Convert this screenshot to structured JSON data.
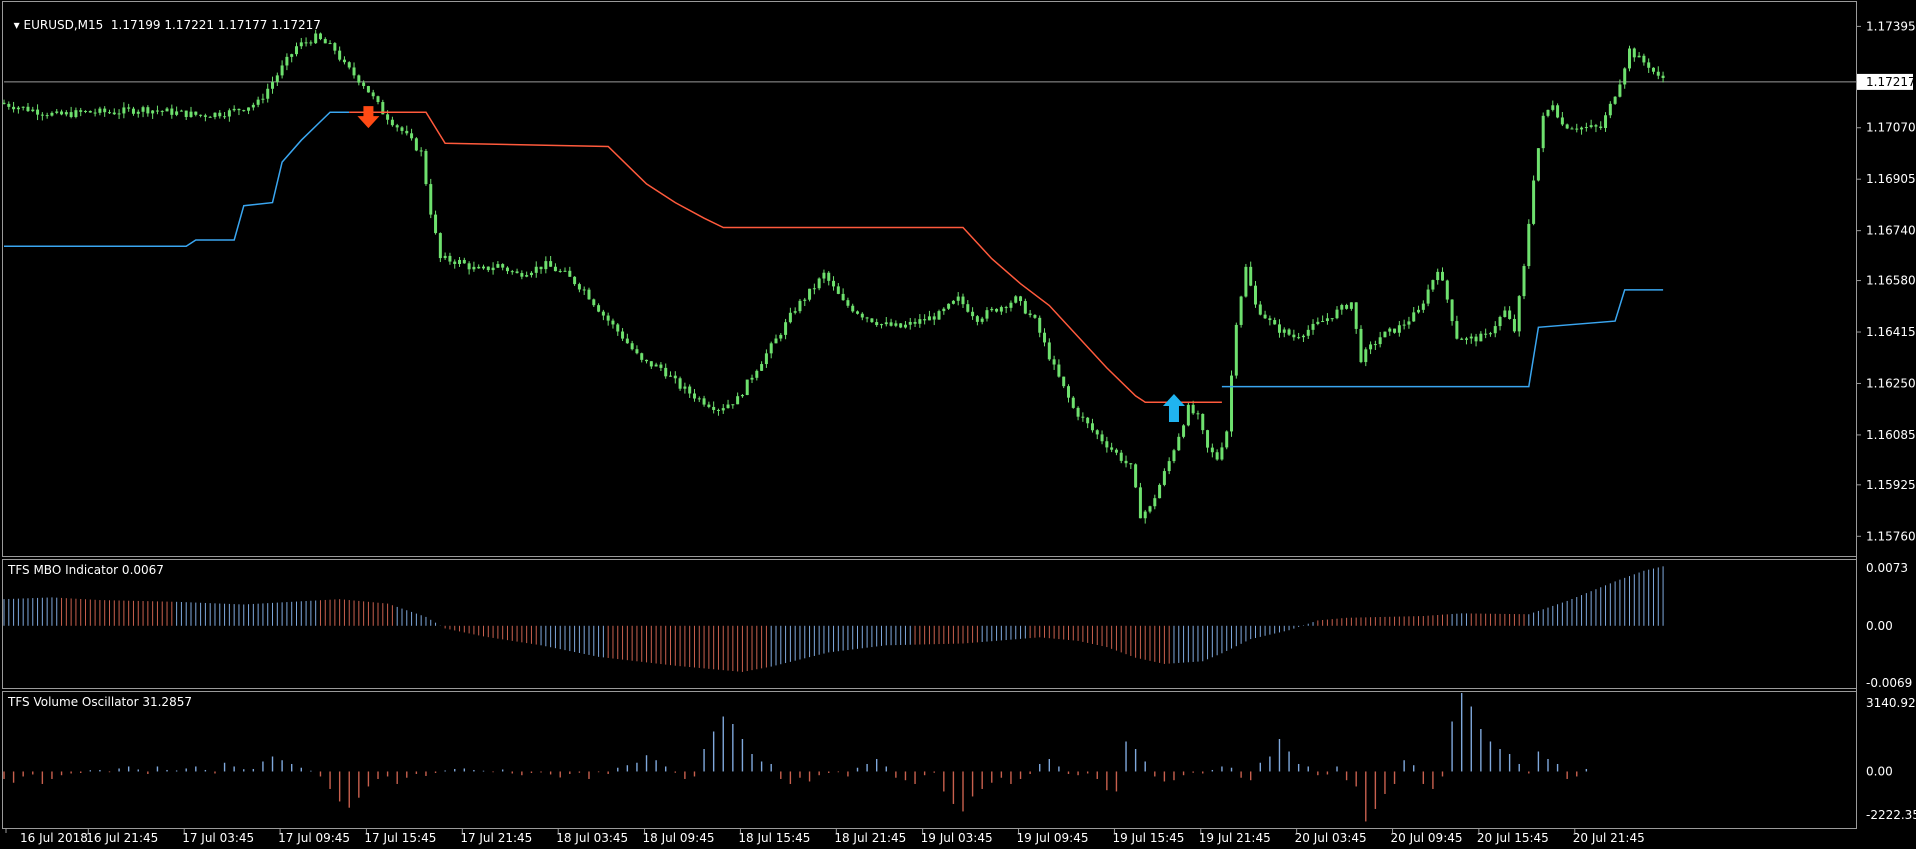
{
  "header": {
    "symbol": "EURUSD,M15",
    "ohlc": "1.17199 1.17221 1.17177 1.17217"
  },
  "colors": {
    "bull": "#6ee06e",
    "up_line": "#3aa6f0",
    "down_line": "#ff5a3c",
    "pos_hist": "#7fa8dc",
    "neg_hist": "#c8604e",
    "grid": "#8a8a8a",
    "price_line": "#9a9a9a"
  },
  "chart_data": [
    {
      "type": "candlestick",
      "name": "EURUSD,M15",
      "y_ticks": [
        "1.17395",
        "1.17070",
        "1.16905",
        "1.16740",
        "1.16580",
        "1.16415",
        "1.16250",
        "1.16085",
        "1.15925",
        "1.15760"
      ],
      "current_price_label": "1.17217",
      "ylim": [
        1.157,
        1.1747
      ],
      "current_price": 1.17217,
      "price_path": [
        [
          0,
          1.1715
        ],
        [
          3,
          1.1713
        ],
        [
          6,
          1.1711
        ],
        [
          9,
          1.1712
        ],
        [
          12,
          1.1712
        ],
        [
          15,
          1.1713
        ],
        [
          18,
          1.1712
        ],
        [
          21,
          1.1711
        ],
        [
          24,
          1.1712
        ],
        [
          27,
          1.1715
        ],
        [
          29,
          1.1724
        ],
        [
          31,
          1.1733
        ],
        [
          33,
          1.1736
        ],
        [
          35,
          1.1732
        ],
        [
          36,
          1.1727
        ],
        [
          38,
          1.1721
        ],
        [
          40,
          1.1712
        ],
        [
          42,
          1.1706
        ],
        [
          44,
          1.1699
        ],
        [
          45,
          1.168
        ],
        [
          46,
          1.1665
        ],
        [
          48,
          1.1664
        ],
        [
          50,
          1.1661
        ],
        [
          52,
          1.1663
        ],
        [
          54,
          1.166
        ],
        [
          56,
          1.1662
        ],
        [
          57,
          1.1663
        ],
        [
          59,
          1.166
        ],
        [
          61,
          1.1655
        ],
        [
          63,
          1.1647
        ],
        [
          65,
          1.164
        ],
        [
          67,
          1.1632
        ],
        [
          69,
          1.163
        ],
        [
          71,
          1.1624
        ],
        [
          73,
          1.162
        ],
        [
          75,
          1.1617
        ],
        [
          77,
          1.162
        ],
        [
          79,
          1.163
        ],
        [
          81,
          1.1639
        ],
        [
          83,
          1.1649
        ],
        [
          85,
          1.1656
        ],
        [
          86,
          1.166
        ],
        [
          88,
          1.1651
        ],
        [
          90,
          1.1647
        ],
        [
          92,
          1.1644
        ],
        [
          94,
          1.1643
        ],
        [
          96,
          1.1645
        ],
        [
          98,
          1.1647
        ],
        [
          100,
          1.1652
        ],
        [
          102,
          1.1646
        ],
        [
          104,
          1.1649
        ],
        [
          106,
          1.1652
        ],
        [
          108,
          1.1645
        ],
        [
          110,
          1.163
        ],
        [
          112,
          1.1617
        ],
        [
          114,
          1.161
        ],
        [
          116,
          1.1604
        ],
        [
          118,
          1.1598
        ],
        [
          119,
          1.1583
        ],
        [
          120,
          1.1585
        ],
        [
          122,
          1.16
        ],
        [
          124,
          1.1617
        ],
        [
          125,
          1.1614
        ],
        [
          126,
          1.1604
        ],
        [
          127,
          1.1601
        ],
        [
          128,
          1.161
        ],
        [
          129,
          1.1645
        ],
        [
          130,
          1.1662
        ],
        [
          131,
          1.165
        ],
        [
          133,
          1.1643
        ],
        [
          135,
          1.164
        ],
        [
          137,
          1.1643
        ],
        [
          139,
          1.1647
        ],
        [
          141,
          1.1651
        ],
        [
          142,
          1.1633
        ],
        [
          144,
          1.164
        ],
        [
          146,
          1.1643
        ],
        [
          148,
          1.1648
        ],
        [
          150,
          1.1662
        ],
        [
          151,
          1.1652
        ],
        [
          152,
          1.164
        ],
        [
          153,
          1.1639
        ],
        [
          155,
          1.164
        ],
        [
          157,
          1.1648
        ],
        [
          158,
          1.1642
        ],
        [
          159,
          1.1662
        ],
        [
          160,
          1.1691
        ],
        [
          161,
          1.171
        ],
        [
          162,
          1.1715
        ],
        [
          163,
          1.1708
        ],
        [
          165,
          1.1707
        ],
        [
          167,
          1.1707
        ],
        [
          168,
          1.1714
        ],
        [
          169,
          1.1722
        ],
        [
          170,
          1.1732
        ],
        [
          171,
          1.1729
        ],
        [
          172,
          1.1727
        ],
        [
          173,
          1.1723
        ]
      ],
      "buy_stop_line": [
        [
          0,
          1.1669
        ],
        [
          19,
          1.1669
        ],
        [
          20,
          1.1671
        ],
        [
          24,
          1.1671
        ],
        [
          25,
          1.1682
        ],
        [
          28,
          1.1683
        ],
        [
          29,
          1.1696
        ],
        [
          31,
          1.1703
        ],
        [
          33,
          1.1709
        ],
        [
          34,
          1.1712
        ],
        [
          36,
          1.1712
        ]
      ],
      "sell_stop_line": [
        [
          36,
          1.1712
        ],
        [
          44,
          1.1712
        ],
        [
          46,
          1.1702
        ],
        [
          63,
          1.1701
        ],
        [
          67,
          1.1689
        ],
        [
          70,
          1.1683
        ],
        [
          73,
          1.1678
        ],
        [
          75,
          1.1675
        ],
        [
          100,
          1.1675
        ],
        [
          103,
          1.1665
        ],
        [
          106,
          1.1657
        ],
        [
          109,
          1.165
        ],
        [
          112,
          1.164
        ],
        [
          115,
          1.163
        ],
        [
          118,
          1.1621
        ],
        [
          119,
          1.1619
        ],
        [
          127,
          1.1619
        ]
      ],
      "buy_line_2": [
        [
          127,
          1.1624
        ],
        [
          159,
          1.1624
        ],
        [
          160,
          1.1643
        ],
        [
          168,
          1.1645
        ],
        [
          169,
          1.1655
        ],
        [
          173,
          1.1655
        ]
      ],
      "signals": [
        {
          "type": "sell",
          "x": 38,
          "y": 1.1712
        },
        {
          "type": "buy",
          "x": 122,
          "y": 1.1621
        }
      ],
      "x_tick_labels": [
        "16 Jul 2018",
        "16 Jul 21:45",
        "17 Jul 03:45",
        "17 Jul 09:45",
        "17 Jul 15:45",
        "17 Jul 21:45",
        "18 Jul 03:45",
        "18 Jul 09:45",
        "18 Jul 15:45",
        "18 Jul 21:45",
        "19 Jul 03:45",
        "19 Jul 09:45",
        "19 Jul 15:45",
        "19 Jul 21:45",
        "20 Jul 03:45",
        "20 Jul 09:45",
        "20 Jul 15:45",
        "20 Jul 21:45"
      ]
    },
    {
      "type": "bar",
      "name": "TFS MBO Indicator 0.0067",
      "y_ticks": [
        "0.0073",
        "0.00",
        "-0.0069"
      ],
      "ylim": [
        -0.0069,
        0.0073
      ],
      "envelope": [
        [
          0,
          0.003
        ],
        [
          5,
          0.0032
        ],
        [
          10,
          0.0029
        ],
        [
          18,
          0.0027
        ],
        [
          25,
          0.0024
        ],
        [
          30,
          0.0027
        ],
        [
          35,
          0.003
        ],
        [
          40,
          0.0025
        ],
        [
          44,
          0.001
        ],
        [
          46,
          -0.0003
        ],
        [
          50,
          -0.0012
        ],
        [
          56,
          -0.0022
        ],
        [
          62,
          -0.0035
        ],
        [
          70,
          -0.0045
        ],
        [
          77,
          -0.0052
        ],
        [
          80,
          -0.0046
        ],
        [
          86,
          -0.003
        ],
        [
          92,
          -0.0022
        ],
        [
          100,
          -0.002
        ],
        [
          108,
          -0.0013
        ],
        [
          112,
          -0.0017
        ],
        [
          115,
          -0.0024
        ],
        [
          118,
          -0.0036
        ],
        [
          121,
          -0.0043
        ],
        [
          125,
          -0.004
        ],
        [
          127,
          -0.0031
        ],
        [
          130,
          -0.0015
        ],
        [
          134,
          -0.0005
        ],
        [
          137,
          0.0006
        ],
        [
          140,
          0.0009
        ],
        [
          148,
          0.0011
        ],
        [
          152,
          0.0014
        ],
        [
          159,
          0.0013
        ],
        [
          163,
          0.0028
        ],
        [
          168,
          0.005
        ],
        [
          171,
          0.0062
        ],
        [
          173,
          0.0067
        ]
      ],
      "negative_runs": [
        [
          6,
          17
        ],
        [
          33,
          40
        ],
        [
          46,
          55
        ],
        [
          63,
          79
        ],
        [
          95,
          101
        ],
        [
          107,
          121
        ],
        [
          137,
          150
        ],
        [
          153,
          158
        ]
      ]
    },
    {
      "type": "bar",
      "name": "TFS Volume Oscillator 31.2857",
      "y_ticks": [
        "3140.9286",
        "0.00",
        "-2222.357"
      ],
      "ylim": [
        -2222.357,
        3140.9286
      ],
      "values": [
        -300,
        -450,
        -200,
        -120,
        -500,
        -300,
        -150,
        -80,
        -60,
        50,
        60,
        -30,
        120,
        200,
        80,
        -100,
        200,
        60,
        40,
        120,
        200,
        60,
        -80,
        350,
        200,
        90,
        100,
        400,
        600,
        450,
        300,
        150,
        30,
        -200,
        -700,
        -1200,
        -1450,
        -1050,
        -600,
        -300,
        -200,
        -500,
        -250,
        -100,
        -180,
        -60,
        40,
        100,
        120,
        60,
        30,
        -30,
        80,
        -80,
        -150,
        -60,
        -40,
        -120,
        -240,
        -100,
        -50,
        -300,
        -30,
        -100,
        150,
        250,
        350,
        650,
        450,
        200,
        -50,
        -300,
        -200,
        900,
        1600,
        2200,
        1900,
        1300,
        700,
        400,
        300,
        -300,
        -500,
        -250,
        -400,
        -150,
        -60,
        -30,
        -200,
        150,
        300,
        500,
        200,
        -250,
        -350,
        -500,
        -150,
        -50,
        -800,
        -1300,
        -1600,
        -1000,
        -700,
        -450,
        -250,
        -500,
        -300,
        -100,
        300,
        500,
        200,
        -100,
        -150,
        -80,
        -300,
        -750,
        -800,
        1200,
        900,
        400,
        -200,
        -400,
        -350,
        -150,
        -50,
        -80,
        60,
        200,
        150,
        -250,
        -350,
        350,
        600,
        1300,
        800,
        300,
        200,
        -150,
        -120,
        200,
        -350,
        -600,
        -2000,
        -1500,
        -900,
        -500,
        450,
        250,
        -500,
        -700,
        -200,
        2000,
        3140,
        2600,
        1700,
        1200,
        900,
        700,
        300,
        -80,
        800,
        500,
        300,
        -300,
        -200,
        100
      ],
      "tick_indices": [
        0,
        9,
        19,
        29,
        38,
        48,
        58,
        67,
        77,
        87,
        96,
        106,
        116,
        125,
        135,
        145,
        154,
        164
      ]
    }
  ]
}
